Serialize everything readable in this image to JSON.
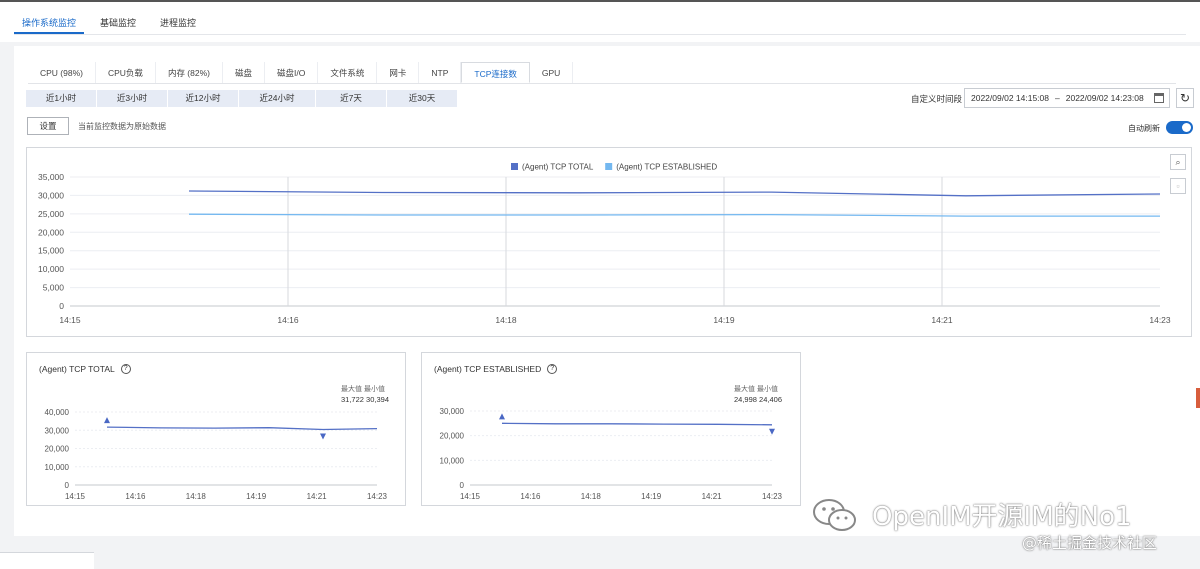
{
  "top_tabs": [
    "操作系统监控",
    "基础监控",
    "进程监控"
  ],
  "metric_tabs": [
    "CPU (98%)",
    "CPU负载",
    "内存 (82%)",
    "磁盘",
    "磁盘I/O",
    "文件系统",
    "网卡",
    "NTP",
    "TCP连接数",
    "GPU"
  ],
  "active_metric_tab": "TCP连接数",
  "range_buttons": [
    "近1小时",
    "近3小时",
    "近12小时",
    "近24小时",
    "近7天",
    "近30天"
  ],
  "custom_range": {
    "label": "自定义时间段",
    "start": "2022/09/02 14:15:08",
    "separator": "–",
    "end": "2022/09/02 14:23:08"
  },
  "settings": {
    "button": "设置",
    "note": "当前监控数据为原始数据"
  },
  "auto_refresh": {
    "label": "自动刷新",
    "on": true
  },
  "chart_data": [
    {
      "type": "line",
      "x": [
        "14:15",
        "14:16",
        "14:18",
        "14:19",
        "14:21",
        "14:23"
      ],
      "yticks": [
        "35,000",
        "30,000",
        "25,000",
        "20,000",
        "15,000",
        "10,000",
        "5,000",
        "0"
      ],
      "ylim": [
        0,
        35000
      ],
      "legend_position": "top-center",
      "series": [
        {
          "name": "(Agent) TCP TOTAL",
          "color": "#5470c6",
          "values": [
            31200,
            30800,
            30700,
            30900,
            29900,
            30400
          ]
        },
        {
          "name": "(Agent) TCP ESTABLISHED",
          "color": "#74b8f0",
          "values": [
            24900,
            24700,
            24700,
            24800,
            24400,
            24400
          ]
        }
      ]
    },
    {
      "type": "line",
      "title": "(Agent) TCP TOTAL",
      "stat_label": "最大值 最小值",
      "max": "31,722",
      "min": "30,394",
      "x": [
        "14:15",
        "14:16",
        "14:18",
        "14:19",
        "14:21",
        "14:23"
      ],
      "yticks": [
        "40,000",
        "30,000",
        "20,000",
        "10,000",
        "0"
      ],
      "ylim": [
        0,
        40000
      ],
      "series": [
        {
          "color": "#5470c6",
          "values": [
            31722,
            31300,
            31200,
            31400,
            30394,
            30900
          ]
        }
      ]
    },
    {
      "type": "line",
      "title": "(Agent) TCP ESTABLISHED",
      "stat_label": "最大值 最小值",
      "max": "24,998",
      "min": "24,406",
      "x": [
        "14:15",
        "14:16",
        "14:18",
        "14:19",
        "14:21",
        "14:23"
      ],
      "yticks": [
        "30,000",
        "20,000",
        "10,000",
        "0"
      ],
      "ylim": [
        0,
        30000
      ],
      "series": [
        {
          "color": "#5470c6",
          "values": [
            24998,
            24800,
            24800,
            24700,
            24600,
            24406
          ]
        }
      ]
    }
  ],
  "watermark": {
    "main": "OpenIM开源IM的No1",
    "sub": "@稀土掘金技术社区"
  }
}
